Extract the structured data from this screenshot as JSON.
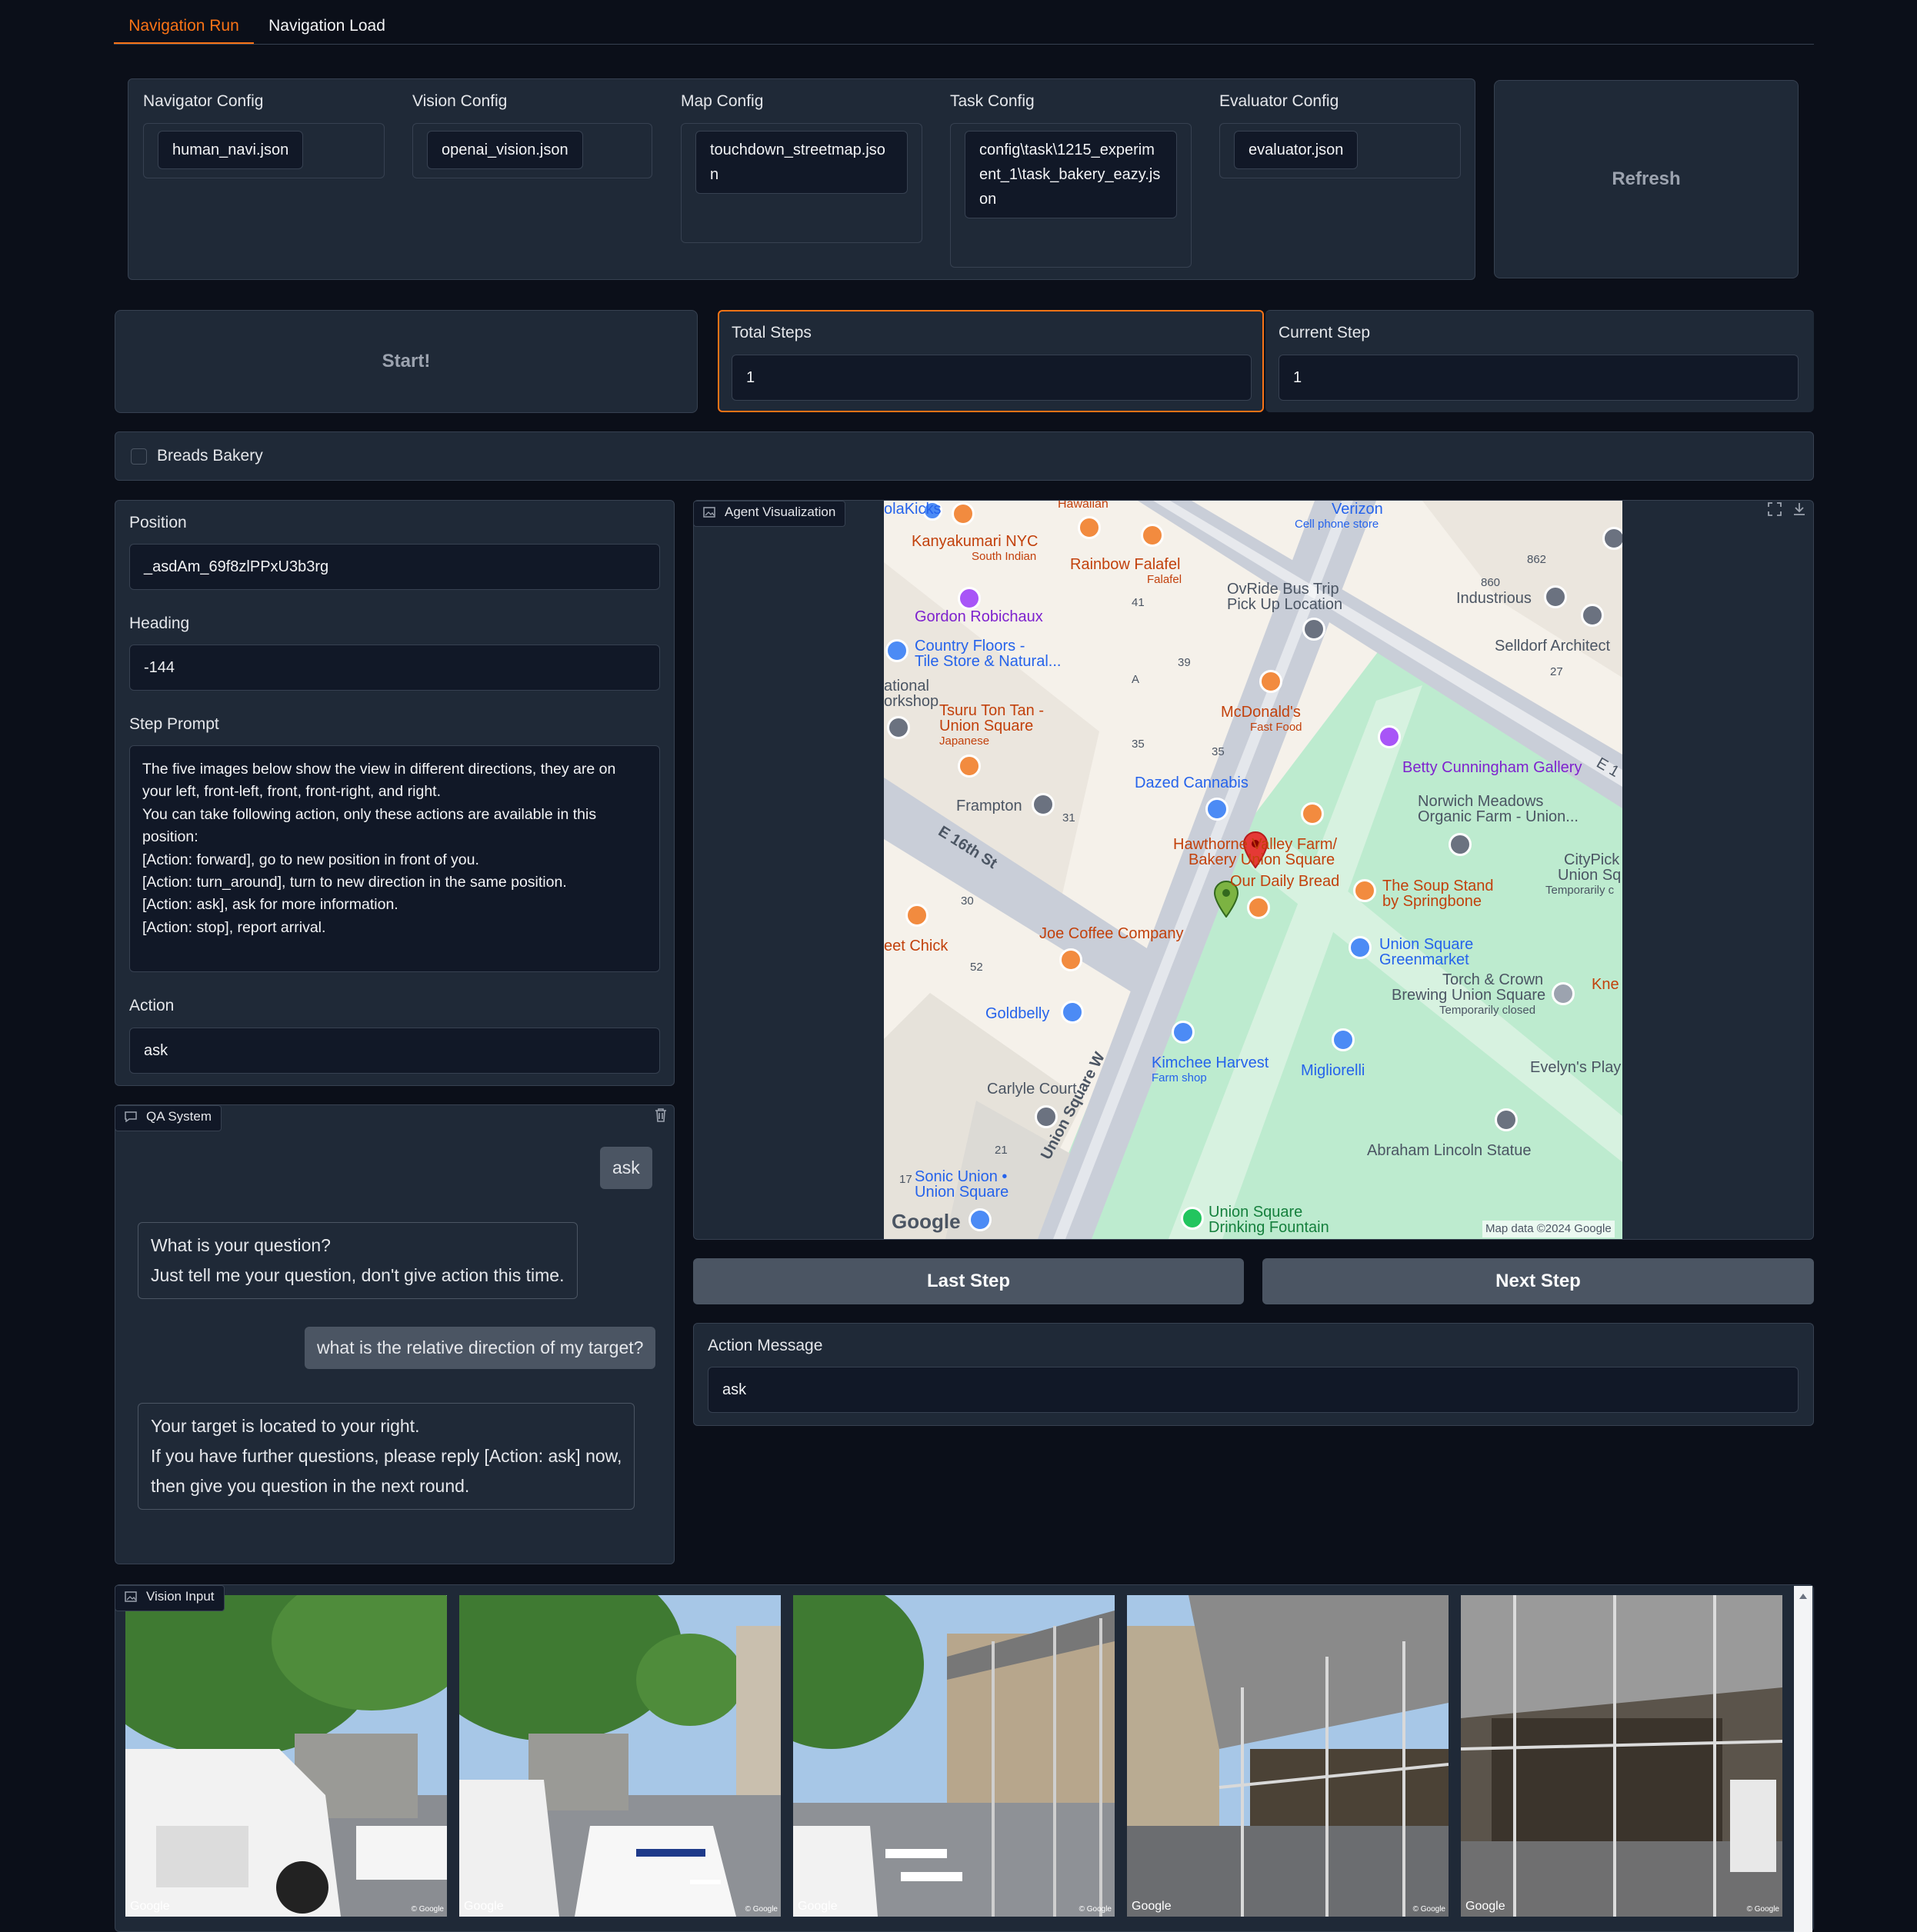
{
  "tabs": [
    {
      "label": "Navigation Run",
      "active": true
    },
    {
      "label": "Navigation Load",
      "active": false
    }
  ],
  "configs": {
    "navigator": {
      "label": "Navigator Config",
      "value": "human_navi.json"
    },
    "vision": {
      "label": "Vision Config",
      "value": "openai_vision.json"
    },
    "map": {
      "label": "Map Config",
      "value_lines": [
        "touchdown_streetmap.jso",
        "n"
      ]
    },
    "task": {
      "label": "Task Config",
      "value_lines": [
        "config\\task\\1215_experim",
        "ent_1\\task_bakery_eazy.js",
        "on"
      ]
    },
    "evaluator": {
      "label": "Evaluator Config",
      "value": "evaluator.json"
    },
    "refresh_label": "Refresh"
  },
  "controls": {
    "start_label": "Start!",
    "total_steps": {
      "label": "Total Steps",
      "value": "1"
    },
    "current_step": {
      "label": "Current Step",
      "value": "1"
    }
  },
  "target": {
    "label": "Breads Bakery",
    "checked": false
  },
  "state": {
    "position": {
      "label": "Position",
      "value": "_asdAm_69f8zlPPxU3b3rg"
    },
    "heading": {
      "label": "Heading",
      "value": "-144"
    },
    "step_prompt": {
      "label": "Step Prompt",
      "lines": [
        "The five images below show the view in different directions, they are on",
        "your left, front-left, front, front-right, and right.",
        "You can take following action, only these actions are available in this",
        "position:",
        "[Action: forward], go to new position in front of you.",
        "[Action: turn_around], turn to new direction in the same position.",
        "[Action: ask], ask for more information.",
        "[Action: stop], report arrival."
      ]
    },
    "action": {
      "label": "Action",
      "value": "ask"
    }
  },
  "qa": {
    "title": "QA System",
    "messages": [
      {
        "role": "user",
        "lines": [
          "ask"
        ]
      },
      {
        "role": "bot",
        "lines": [
          "What is your question?",
          "Just tell me your question, don't give action this time."
        ]
      },
      {
        "role": "user",
        "lines": [
          "what is the relative direction of my target?"
        ]
      },
      {
        "role": "bot",
        "lines": [
          "Your target is located to your right.",
          "If you have further questions, please reply [Action: ask] now,",
          "then give you question in the next round."
        ]
      }
    ]
  },
  "visualization": {
    "title": "Agent Visualization",
    "map_labels": {
      "kanyakumari": "Kanyakumari NYC",
      "kanyakumari_sub": "South Indian",
      "rainbow": "Rainbow Falafel",
      "rainbow_sub": "Falafel",
      "hawaiian": "Hawaiian",
      "olakicks": "olaKicks",
      "verizon": "Verizon",
      "verizon_sub": "Cell phone store",
      "ovride1": "OvRide Bus Trip",
      "ovride2": "Pick Up Location",
      "industrious": "Industrious",
      "selldorf": "Selldorf Architect",
      "gordon": "Gordon Robichaux",
      "country1": "Country Floors -",
      "country2": "Tile Store & Natural...",
      "national1": "ational",
      "national2": "orkshop",
      "tsuru1": "Tsuru Ton Tan -",
      "tsuru2": "Union Square",
      "tsuru_sub": "Japanese",
      "mcdonalds": "McDonald's",
      "mcdonalds_sub": "Fast Food",
      "betty": "Betty Cunningham Gallery",
      "dazed": "Dazed Cannabis",
      "frampton": "Frampton",
      "e16": "E 16th St",
      "e17": "E 1",
      "norwich1": "Norwich Meadows",
      "norwich2": "Organic Farm - Union...",
      "citypick1": "CityPick",
      "citypick2": "Union Sq",
      "citypick_sub": "Temporarily c",
      "hawthorne1": "Hawthorne Valley Farm/",
      "hawthorne2": "Bakery Union Square",
      "daily": "Our Daily Bread",
      "soup1": "The Soup Stand",
      "soup2": "by Springbone",
      "joe": "Joe Coffee Company",
      "street_chick": "eet Chick",
      "greenmarket1": "Union Square",
      "greenmarket2": "Greenmarket",
      "torch1": "Torch & Crown",
      "torch2": "Brewing Union Square",
      "torch_sub": "Temporarily closed",
      "kne": "Kne",
      "goldbelly": "Goldbelly",
      "kimchee": "Kimchee Harvest",
      "kimchee_sub": "Farm shop",
      "migliorelli": "Migliorelli",
      "evelyn": "Evelyn's Play",
      "carlyle": "Carlyle Court",
      "abraham": "Abraham Lincoln Statue",
      "sonic1": "Sonic Union •",
      "sonic2": "Union Square",
      "union_sq_w": "Union Square W",
      "fountain1": "Union Square",
      "fountain2": "Drinking Fountain",
      "google": "Google",
      "attribution": "Map data ©2024 Google",
      "n862": "862",
      "n860": "860",
      "n41": "41",
      "n39": "39",
      "n27": "27",
      "nA": "A",
      "n35a": "35",
      "n35b": "35",
      "n31": "31",
      "n30": "30",
      "n52": "52",
      "n21": "21",
      "n17": "17"
    }
  },
  "navigation": {
    "last_label": "Last Step",
    "next_label": "Next Step"
  },
  "action_message": {
    "label": "Action Message",
    "value": "ask"
  },
  "vision_input": {
    "title": "Vision Input",
    "watermark": "Google",
    "watermark_small": "© Google"
  },
  "colors": {
    "accent": "#f97316",
    "map_park": "#bdebcf",
    "map_bg": "#f5f1ea"
  }
}
